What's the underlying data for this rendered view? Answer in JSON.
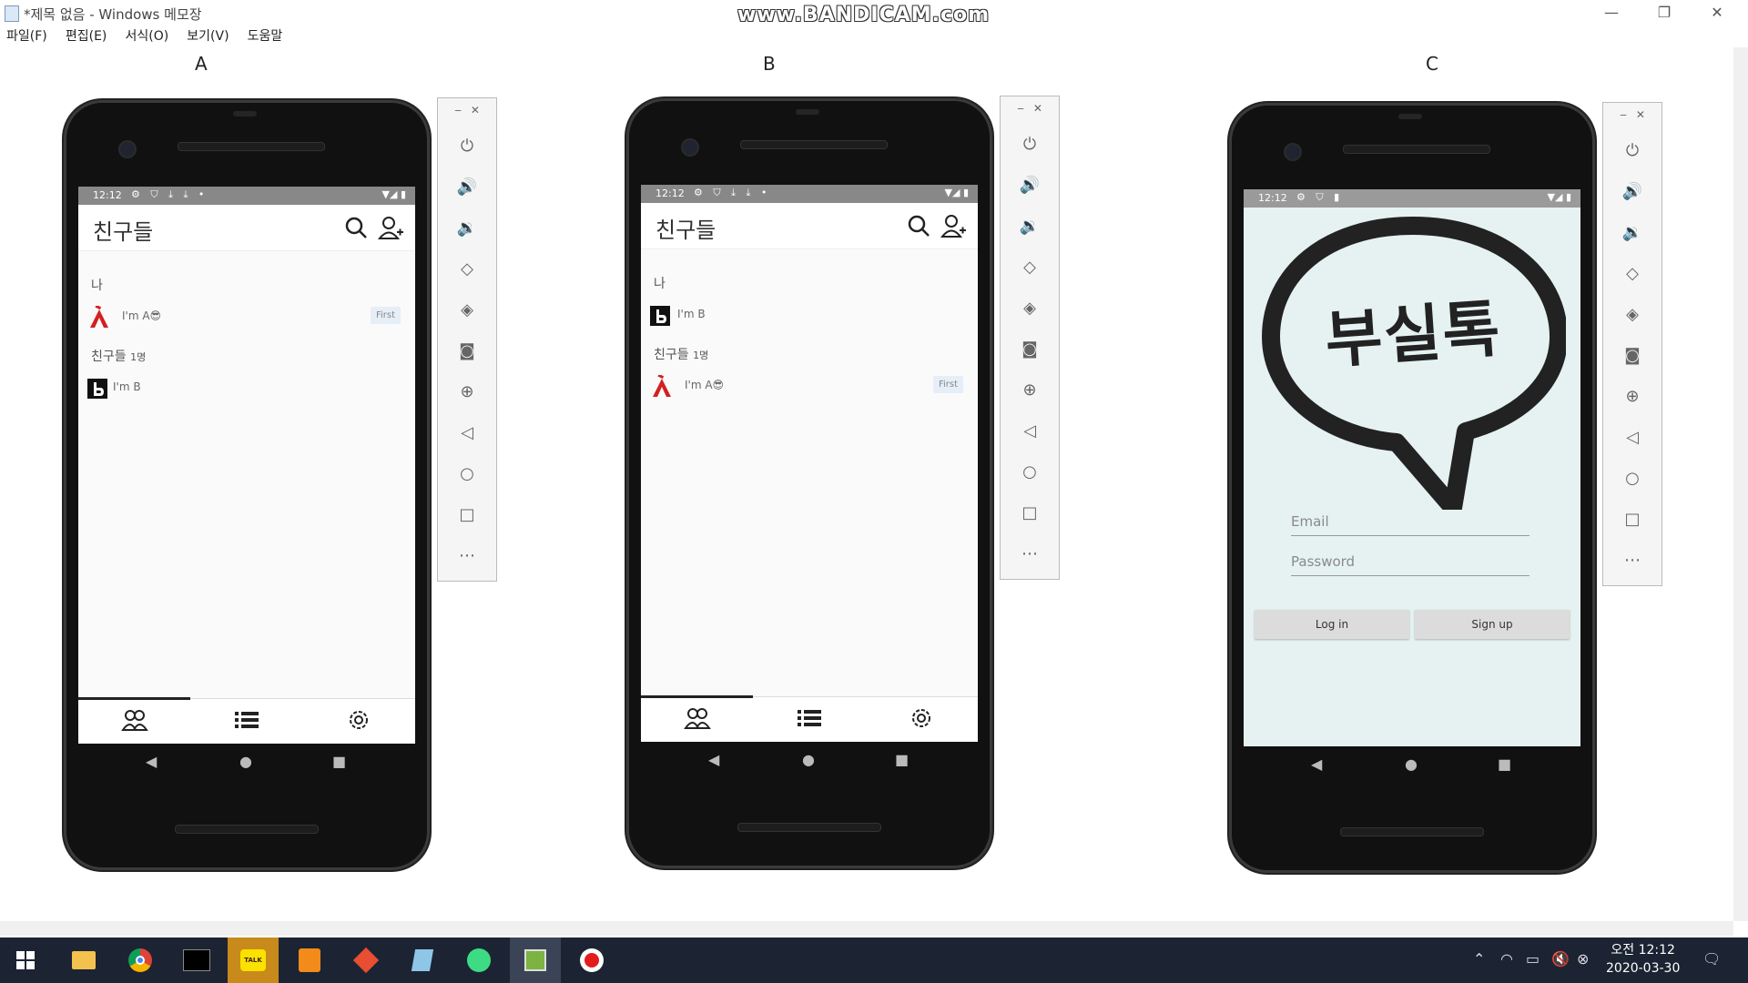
{
  "window": {
    "title": "*제목 없음 - Windows 메모장",
    "watermark": "www.BANDICAM.com",
    "menu": [
      "파일(F)",
      "편집(E)",
      "서식(O)",
      "보기(V)",
      "도움말"
    ]
  },
  "labels": {
    "a": "A",
    "b": "B",
    "c": "C"
  },
  "phone_a": {
    "status_time": "12:12",
    "app_title": "친구들",
    "me_section": "나",
    "me_name": "I'm A😎",
    "me_badge": "First",
    "friends_section": "친구들",
    "friends_count": "1명",
    "friend_name": "I'm B"
  },
  "phone_b": {
    "status_time": "12:12",
    "app_title": "친구들",
    "me_section": "나",
    "me_name": "I'm B",
    "friends_section": "친구들",
    "friends_count": "1명",
    "friend_name": "I'm A😎",
    "friend_badge": "First"
  },
  "phone_c": {
    "status_time": "12:12",
    "logo_text": "부실톡",
    "email_placeholder": "Email",
    "password_placeholder": "Password",
    "login_label": "Log in",
    "signup_label": "Sign up"
  },
  "emulator_toolbar_icons": [
    "power-icon",
    "volume-up-icon",
    "volume-down-icon",
    "rotate-left-icon",
    "rotate-right-icon",
    "camera-icon",
    "zoom-icon",
    "back-icon",
    "home-icon",
    "overview-icon",
    "more-icon"
  ],
  "taskbar": {
    "apps": [
      "windows-start-icon",
      "file-explorer-icon",
      "chrome-icon",
      "terminal-icon",
      "kakaotalk-icon",
      "sublime-text-icon",
      "git-icon",
      "notepad-icon",
      "android-studio-icon",
      "emulator-icon",
      "bandicam-record-icon"
    ],
    "kakao_label": "TALK",
    "clock_time": "오전 12:12",
    "clock_date": "2020-03-30"
  }
}
